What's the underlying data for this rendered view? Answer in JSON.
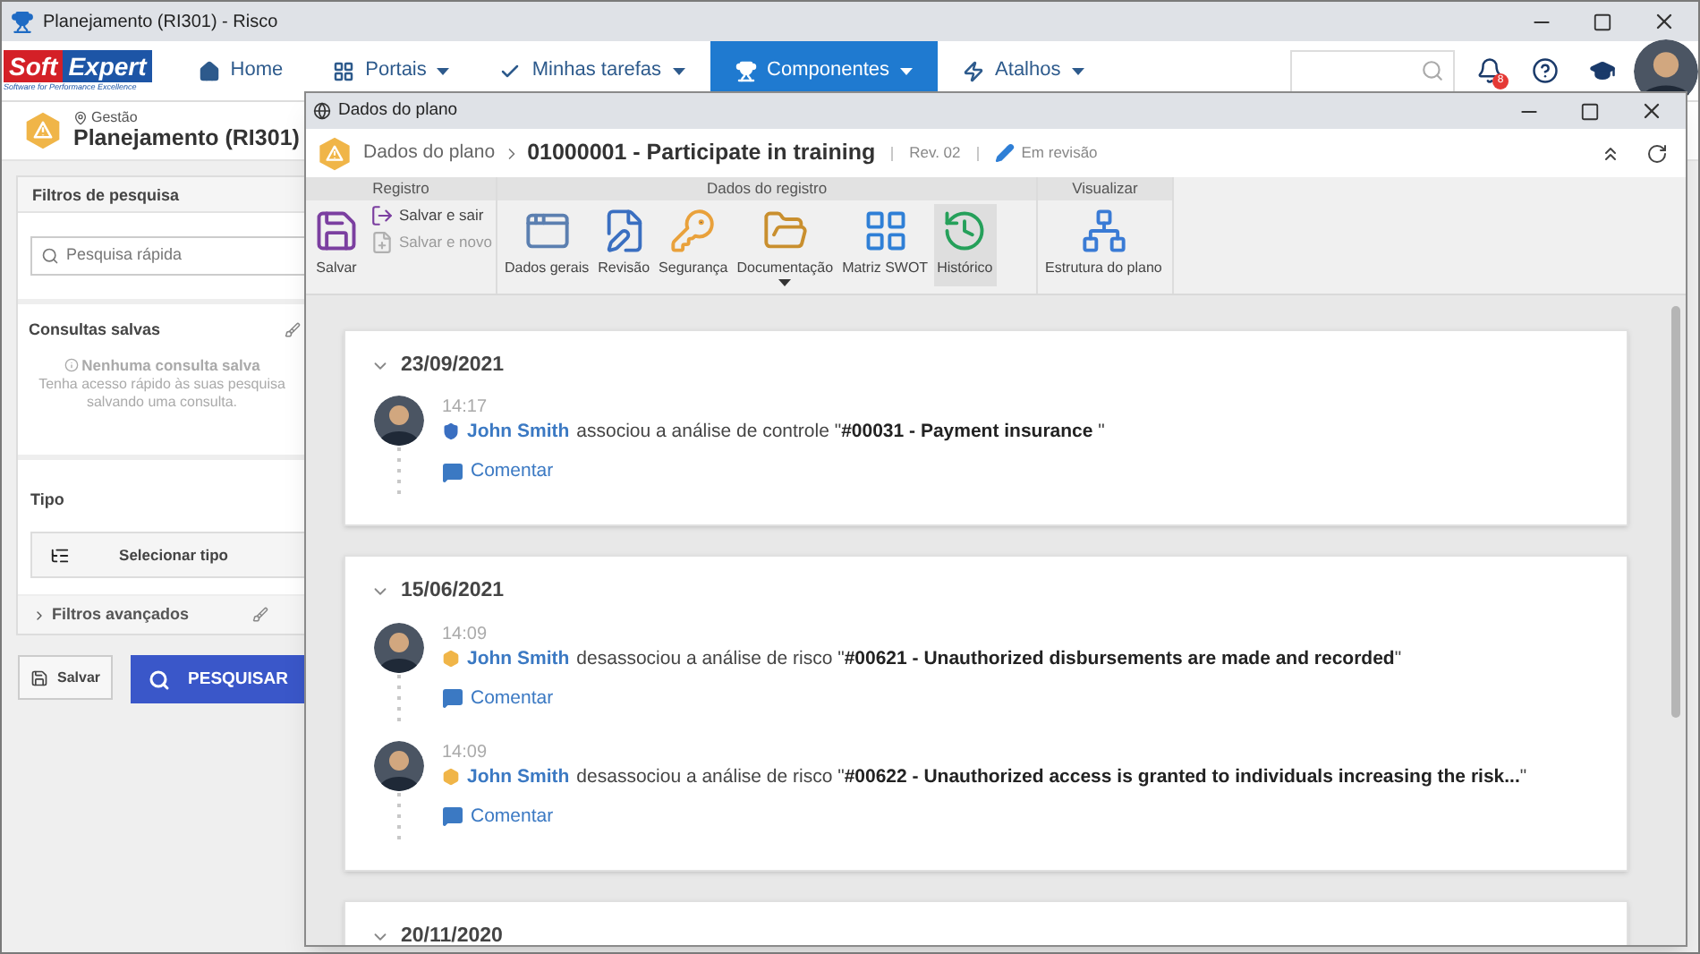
{
  "window": {
    "title": "Planejamento (RI301) - Risco"
  },
  "nav": {
    "logo": {
      "left": "Soft",
      "right": "Expert",
      "tagline": "Software for Performance Excellence"
    },
    "items": [
      {
        "label": "Home",
        "selected": false,
        "caret": false
      },
      {
        "label": "Portais",
        "selected": false,
        "caret": true
      },
      {
        "label": "Minhas tarefas",
        "selected": false,
        "caret": true
      },
      {
        "label": "Componentes",
        "selected": true,
        "caret": true
      },
      {
        "label": "Atalhos",
        "selected": false,
        "caret": true
      }
    ],
    "notification_count": "8"
  },
  "page": {
    "breadcrumb": "Gestão",
    "title": "Planejamento (RI301)"
  },
  "filters": {
    "title": "Filtros de pesquisa",
    "search_placeholder": "Pesquisa rápida",
    "saved_title": "Consultas salvas",
    "empty_title": "Nenhuma consulta salva",
    "empty_lines": [
      "Tenha acesso rápido às suas pesquisa",
      "salvando uma consulta."
    ],
    "type_label": "Tipo",
    "type_button": "Selecionar tipo",
    "advanced": "Filtros avançados",
    "save_button": "Salvar",
    "search_button": "PESQUISAR"
  },
  "dialog": {
    "title": "Dados do plano",
    "breadcrumb_root": "Dados do plano",
    "record": "01000001 - Participate in training",
    "revision": "Rev. 02",
    "status": "Em revisão",
    "ribbon": [
      {
        "title": "Registro",
        "items": [
          {
            "label": "Salvar",
            "kind": "large",
            "selected": false,
            "disabled": false,
            "menu": false
          },
          {
            "label": "Salvar e sair",
            "kind": "small",
            "selected": false,
            "disabled": false,
            "menu": false
          },
          {
            "label": "Salvar e novo",
            "kind": "small",
            "selected": false,
            "disabled": true,
            "menu": false
          }
        ]
      },
      {
        "title": "Dados do registro",
        "items": [
          {
            "label": "Dados gerais",
            "kind": "large",
            "selected": false,
            "disabled": false,
            "menu": false
          },
          {
            "label": "Revisão",
            "kind": "large",
            "selected": false,
            "disabled": false,
            "menu": false
          },
          {
            "label": "Segurança",
            "kind": "large",
            "selected": false,
            "disabled": false,
            "menu": false
          },
          {
            "label": "Documentação",
            "kind": "large",
            "selected": false,
            "disabled": false,
            "menu": true
          },
          {
            "label": "Matriz SWOT",
            "kind": "large",
            "selected": false,
            "disabled": false,
            "menu": false
          },
          {
            "label": "Histórico",
            "kind": "large",
            "selected": true,
            "disabled": false,
            "menu": false
          }
        ]
      },
      {
        "title": "Visualizar",
        "items": [
          {
            "label": "Estrutura do plano",
            "kind": "large",
            "selected": false,
            "disabled": false,
            "menu": false
          }
        ]
      }
    ],
    "timeline": [
      {
        "date": "23/09/2021",
        "expanded": true,
        "entries": [
          {
            "time": "14:17",
            "user": "John Smith",
            "kind": "control",
            "text": "associou a análise de controle \"**#00031 - Payment insurance** \"",
            "action": "Comentar"
          }
        ]
      },
      {
        "date": "15/06/2021",
        "expanded": true,
        "entries": [
          {
            "time": "14:09",
            "user": "John Smith",
            "kind": "risk",
            "text": "desassociou a análise de risco \"**#00621 - Unauthorized disbursements are made and recorded**\"",
            "action": "Comentar"
          },
          {
            "time": "14:09",
            "user": "John Smith",
            "kind": "risk",
            "text": "desassociou a análise de risco \"**#00622 - Unauthorized access is granted to individuals increasing the risk...**\"",
            "action": "Comentar"
          }
        ]
      },
      {
        "date": "20/11/2020",
        "expanded": true
      }
    ]
  }
}
